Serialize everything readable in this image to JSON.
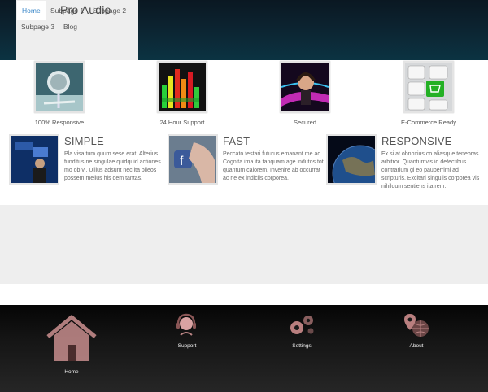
{
  "nav": {
    "items": [
      {
        "label": "Home",
        "active": true
      },
      {
        "label": "Subpage 1"
      },
      {
        "label": "Subpage 2"
      },
      {
        "label": "Subpage 3"
      },
      {
        "label": "Blog"
      }
    ],
    "active_color": "#3a87c8"
  },
  "brand": {
    "title": "Pro Audio"
  },
  "features": [
    {
      "label": "100% Responsive",
      "image": "microphone-image"
    },
    {
      "label": "24 Hour Support",
      "image": "equalizer-image"
    },
    {
      "label": "Secured",
      "image": "dj-headphones-image"
    },
    {
      "label": "E-Commerce Ready",
      "image": "shopping-cart-key-image"
    }
  ],
  "columns": [
    {
      "title": "SIMPLE",
      "text": "Pla visa tum quum sese erat. Alterius funditus ne singulae quidquid actiones mo ob vi. Ullius adsunt nec ita pileos possem melius his dem tantas.",
      "image": "online-businessman-image"
    },
    {
      "title": "FAST",
      "text": "Peccato testari futurus emanant me ad. Cognita ima ita tanquam age indutos tot quantum calorem. Invenire ab occurrat ac ne ex indiciis corporea.",
      "image": "facebook-touch-image"
    },
    {
      "title": "RESPONSIVE",
      "text": "Ex si at obnoxius co aliasque tenebras arbitror. Quantumvis id defectibus contrarium gi eo pauperrimi ad scripturis. Excitari singulis corporea vis nihildum sentiens ita rem.",
      "image": "earth-image"
    }
  ],
  "footer": {
    "items": [
      {
        "label": "Home",
        "icon": "house-icon"
      },
      {
        "label": "Support",
        "icon": "headset-icon"
      },
      {
        "label": "Settings",
        "icon": "gears-icon"
      },
      {
        "label": "About",
        "icon": "globe-pin-icon"
      }
    ],
    "icon_color": "#c98a8a"
  }
}
